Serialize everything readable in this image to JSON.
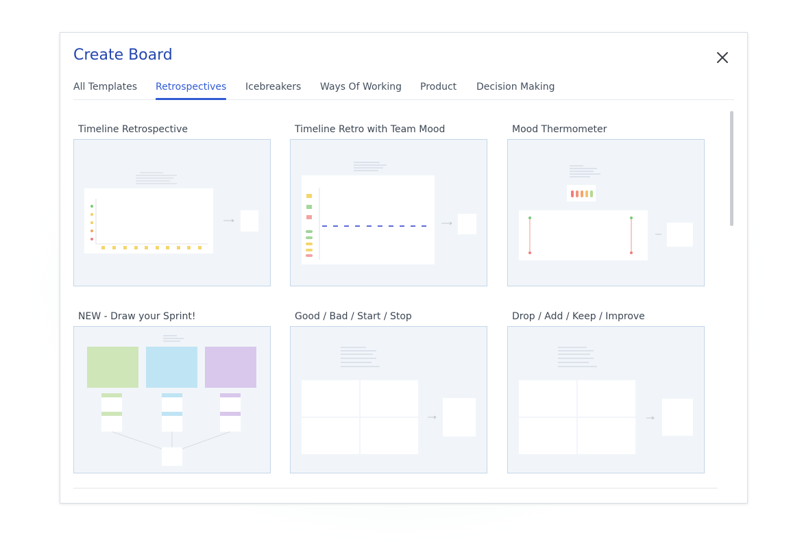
{
  "dialog": {
    "title": "Create Board",
    "close_icon": "close-icon"
  },
  "tabs": [
    {
      "label": "All Templates",
      "active": false
    },
    {
      "label": "Retrospectives",
      "active": true
    },
    {
      "label": "Icebreakers",
      "active": false
    },
    {
      "label": "Ways Of Working",
      "active": false
    },
    {
      "label": "Product",
      "active": false
    },
    {
      "label": "Decision Making",
      "active": false
    }
  ],
  "templates": [
    {
      "name": "Timeline Retrospective"
    },
    {
      "name": "Timeline Retro with Team Mood"
    },
    {
      "name": "Mood Thermometer"
    },
    {
      "name": "NEW - Draw your Sprint!"
    },
    {
      "name": "Good / Bad / Start / Stop"
    },
    {
      "name": "Drop / Add / Keep / Improve"
    }
  ],
  "colors": {
    "accent": "#2f5bd3",
    "title": "#2346b0"
  }
}
